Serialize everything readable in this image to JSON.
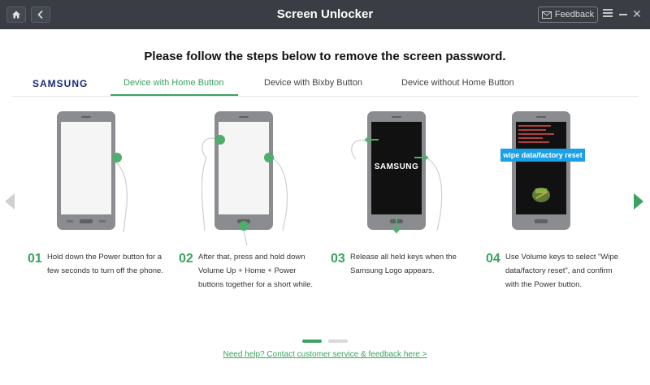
{
  "titlebar": {
    "title": "Screen Unlocker",
    "feedback_label": "Feedback"
  },
  "heading": "Please follow the steps below to remove the screen password.",
  "tabs": {
    "brand": "SAMSUNG",
    "items": [
      {
        "label": "Device with Home Button",
        "active": true
      },
      {
        "label": "Device with Bixby Button",
        "active": false
      },
      {
        "label": "Device without Home Button",
        "active": false
      }
    ]
  },
  "steps": [
    {
      "num": "01",
      "lines": [
        "Hold down the Power button for a",
        "few seconds to turn off the phone."
      ]
    },
    {
      "num": "02",
      "lines": [
        "After that, press and hold down",
        "Volume Up + Home + Power",
        "buttons together for a short while."
      ]
    },
    {
      "num": "03",
      "lines": [
        "Release all held keys when the",
        "Samsung Logo appears."
      ]
    },
    {
      "num": "04",
      "lines": [
        "Use Volume keys to select \"Wipe",
        "data/factory reset\", and confirm",
        "with the Power button."
      ]
    }
  ],
  "phone3_logo": "SAMSUNG",
  "phone4_badge": "wipe data/factory reset",
  "pager": {
    "active_index": 0,
    "count": 2
  },
  "help_link": "Need help? Contact customer service & feedback here >",
  "colors": {
    "accent": "#3aa35f",
    "titlebar": "#3a3d44",
    "badge": "#1aa0e6",
    "brand": "#1a2a7a"
  }
}
